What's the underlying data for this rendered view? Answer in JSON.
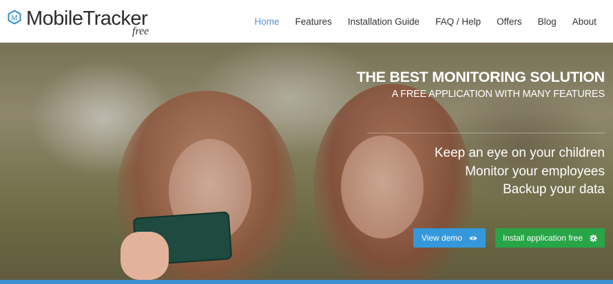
{
  "brand": {
    "title": "MobileTracker",
    "subtitle": "free",
    "badge_letter": "M",
    "accent_color": "#2d8fce"
  },
  "nav": {
    "items": [
      {
        "label": "Home",
        "active": true
      },
      {
        "label": "Features",
        "active": false
      },
      {
        "label": "Installation Guide",
        "active": false
      },
      {
        "label": "FAQ / Help",
        "active": false
      },
      {
        "label": "Offers",
        "active": false
      },
      {
        "label": "Blog",
        "active": false
      },
      {
        "label": "About",
        "active": false
      }
    ],
    "active_color": "#5b8fd6"
  },
  "hero": {
    "title": "THE BEST MONITORING SOLUTION",
    "subtitle": "A FREE APPLICATION WITH MANY FEATURES",
    "features": [
      "Keep an eye on your children",
      "Monitor your employees",
      "Backup your data"
    ],
    "buttons": {
      "demo": {
        "label": "View demo",
        "icon": "eye-icon",
        "color": "#3498db"
      },
      "install": {
        "label": "Install application free",
        "icon": "gear-icon",
        "color": "#27a547"
      }
    }
  }
}
